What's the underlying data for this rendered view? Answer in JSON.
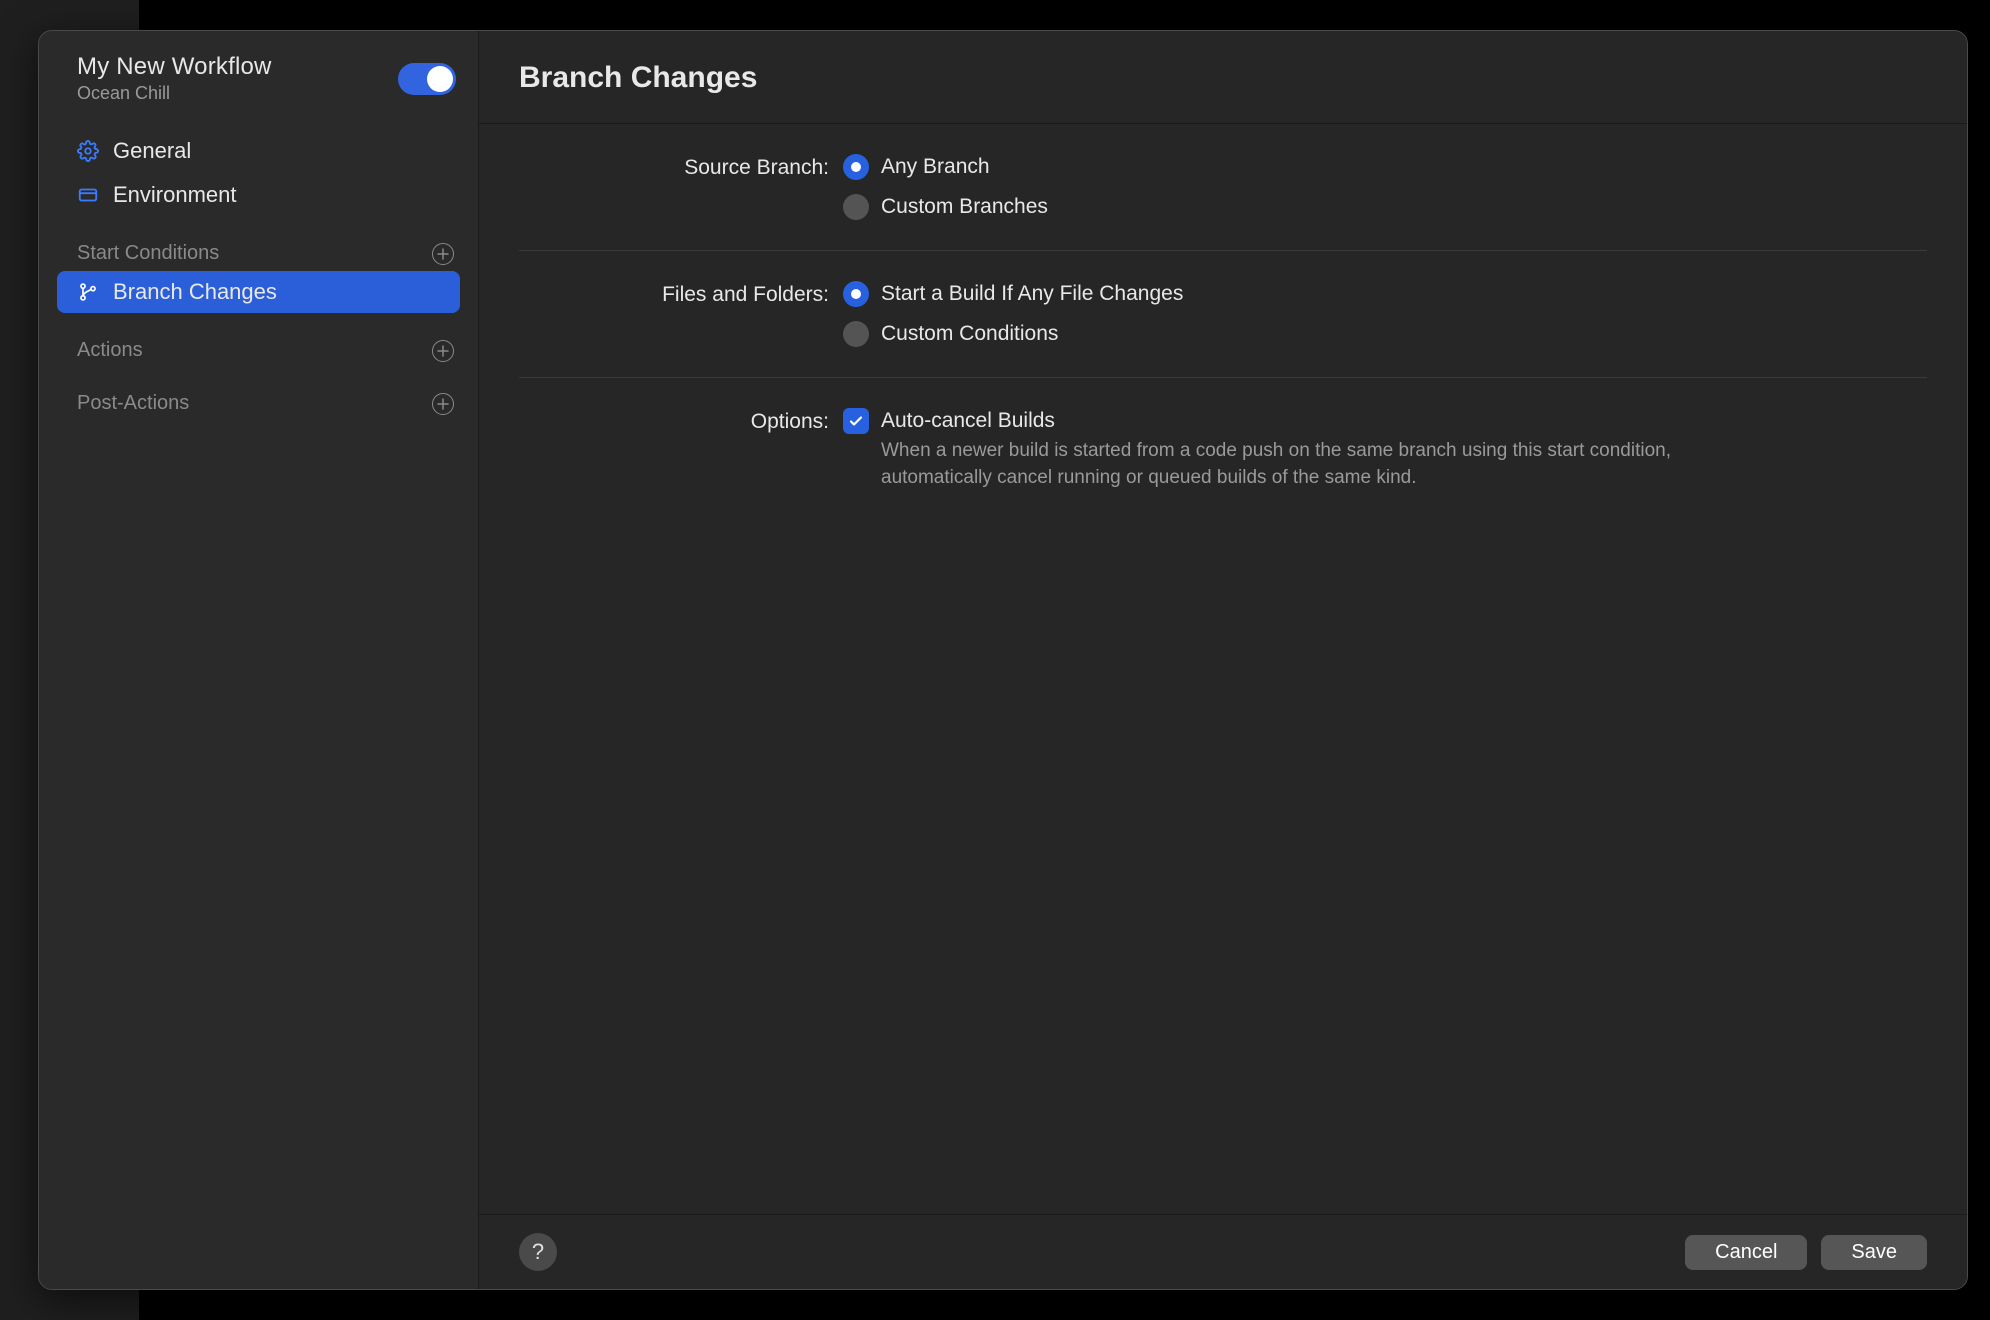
{
  "sidebar": {
    "title": "My New Workflow",
    "subtitle": "Ocean Chill",
    "toggle_on": true,
    "nav": {
      "general": "General",
      "environment": "Environment"
    },
    "sections": {
      "start_conditions": {
        "label": "Start Conditions",
        "items": [
          {
            "label": "Branch Changes",
            "selected": true
          }
        ]
      },
      "actions": {
        "label": "Actions"
      },
      "post_actions": {
        "label": "Post-Actions"
      }
    }
  },
  "main": {
    "title": "Branch Changes",
    "source_branch": {
      "label": "Source Branch:",
      "options": {
        "any": "Any Branch",
        "custom": "Custom Branches"
      },
      "selected": "any"
    },
    "files_folders": {
      "label": "Files and Folders:",
      "options": {
        "any": "Start a Build If Any File Changes",
        "custom": "Custom Conditions"
      },
      "selected": "any"
    },
    "options": {
      "label": "Options:",
      "auto_cancel": {
        "label": "Auto-cancel Builds",
        "checked": true,
        "description": "When a newer build is started from a code push on the same branch using this start condition, automatically cancel running or queued builds of the same kind."
      }
    }
  },
  "footer": {
    "help": "?",
    "cancel": "Cancel",
    "save": "Save"
  }
}
